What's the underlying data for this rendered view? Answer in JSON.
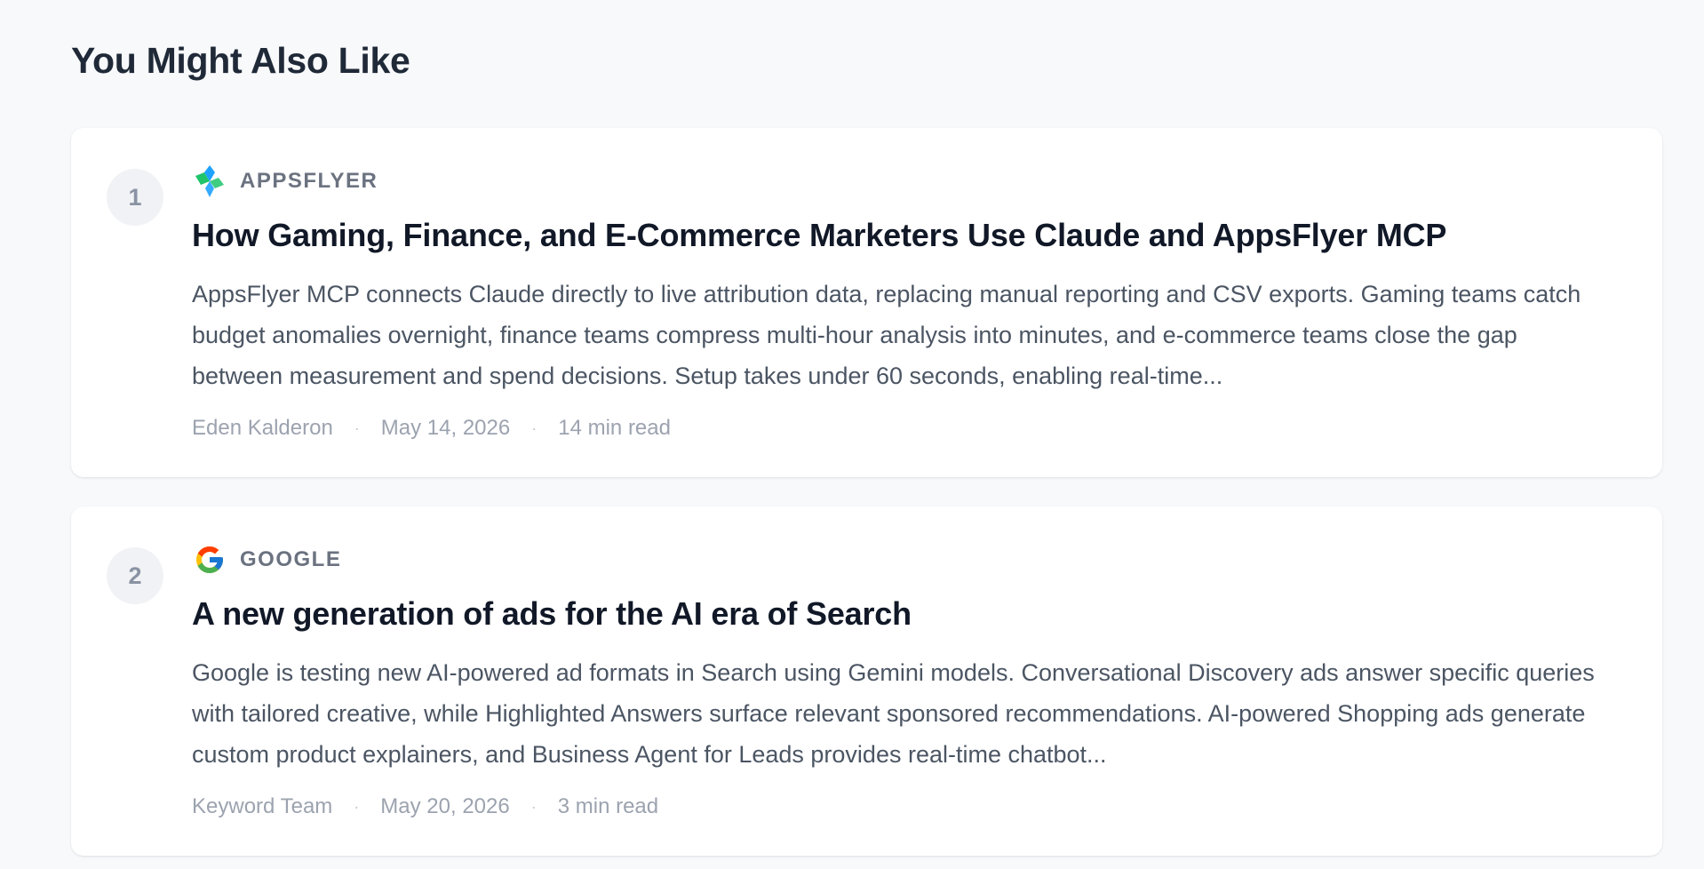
{
  "section": {
    "title": "You Might Also Like"
  },
  "articles": [
    {
      "rank": "1",
      "source": "APPSFLYER",
      "source_icon": "appsflyer-logo-icon",
      "title": "How Gaming, Finance, and E-Commerce Marketers Use Claude and AppsFlyer MCP",
      "excerpt": "AppsFlyer MCP connects Claude directly to live attribution data, replacing manual reporting and CSV exports. Gaming teams catch budget anomalies overnight, finance teams compress multi-hour analysis into minutes, and e-commerce teams close the gap between measurement and spend decisions. Setup takes under 60 seconds, enabling real-time...",
      "author": "Eden Kalderon",
      "date": "May 14, 2026",
      "read_time": "14 min read"
    },
    {
      "rank": "2",
      "source": "GOOGLE",
      "source_icon": "google-logo-icon",
      "title": "A new generation of ads for the AI era of Search",
      "excerpt": "Google is testing new AI-powered ad formats in Search using Gemini models. Conversational Discovery ads answer specific queries with tailored creative, while Highlighted Answers surface relevant sponsored recommendations. AI-powered Shopping ads generate custom product explainers, and Business Agent for Leads provides real-time chatbot...",
      "author": "Keyword Team",
      "date": "May 20, 2026",
      "read_time": "3 min read"
    }
  ],
  "meta_separator": "·"
}
